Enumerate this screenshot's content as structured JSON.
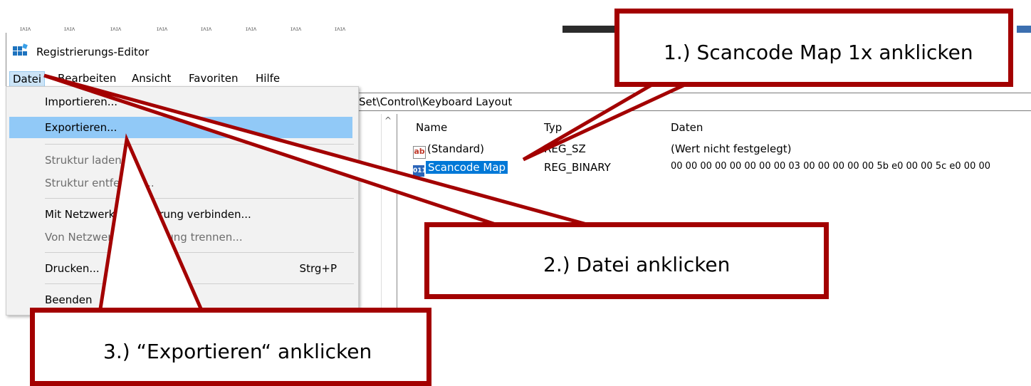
{
  "window": {
    "title": "Registrierungs-Editor",
    "icon": "registry-editor-icon"
  },
  "menubar": {
    "items": [
      "Datei",
      "Bearbeiten",
      "Ansicht",
      "Favoriten",
      "Hilfe"
    ]
  },
  "address": {
    "path": "Set\\Control\\Keyboard Layout"
  },
  "file_menu": {
    "items": [
      {
        "label": "Importieren...",
        "shortcut": "",
        "enabled": true
      },
      {
        "label": "Exportieren...",
        "shortcut": "",
        "enabled": true
      },
      {
        "label": "Struktur laden...",
        "shortcut": "",
        "enabled": false
      },
      {
        "label": "Struktur entfernen...",
        "shortcut": "",
        "enabled": false
      },
      {
        "label": "Mit Netzwerkregistrierung verbinden...",
        "shortcut": "",
        "enabled": true
      },
      {
        "label": "Von Netzwerkregistrierung trennen...",
        "shortcut": "",
        "enabled": false
      },
      {
        "label": "Drucken...",
        "shortcut": "Strg+P",
        "enabled": true
      },
      {
        "label": "Beenden",
        "shortcut": "",
        "enabled": true
      }
    ]
  },
  "values_list": {
    "columns": [
      "Name",
      "Typ",
      "Daten"
    ],
    "rows": [
      {
        "icon": "string-value-icon",
        "name": "(Standard)",
        "type": "REG_SZ",
        "data": "(Wert nicht festgelegt)",
        "selected": false
      },
      {
        "icon": "binary-value-icon",
        "name": "Scancode Map",
        "type": "REG_BINARY",
        "data": "00 00 00 00 00 00 00 00 03 00 00 00 00 00 5b e0 00 00 5c e0 00 00",
        "selected": true
      }
    ]
  },
  "callouts": {
    "step1": "1.) Scancode Map 1x anklicken",
    "step2": "2.) Datei anklicken",
    "step3": "3.) “Exportieren“ anklicken"
  },
  "colors": {
    "callout_border": "#a30000",
    "menu_hover": "#91c9f7",
    "selection": "#0078d7"
  }
}
